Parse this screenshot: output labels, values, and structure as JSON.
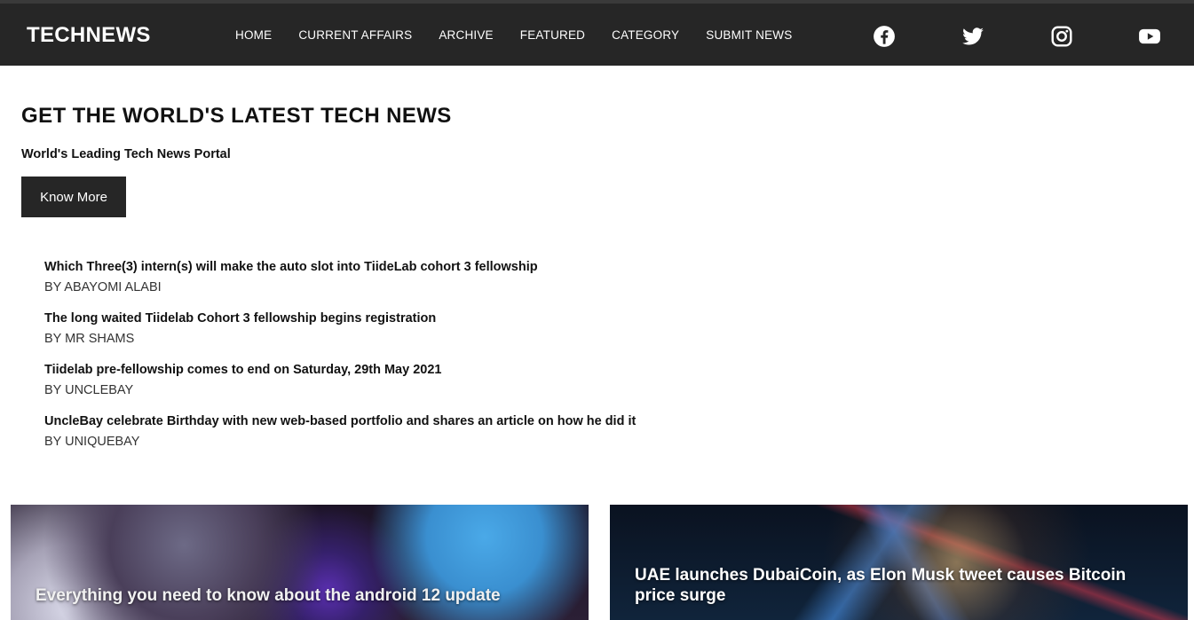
{
  "header": {
    "brand": "TECHNEWS",
    "nav": [
      "HOME",
      "CURRENT AFFAIRS",
      "ARCHIVE",
      "FEATURED",
      "CATEGORY",
      "SUBMIT NEWS"
    ],
    "social_icons": [
      "facebook-icon",
      "twitter-icon",
      "instagram-icon",
      "youtube-icon"
    ]
  },
  "hero": {
    "title": "GET THE WORLD'S LATEST TECH NEWS",
    "subtitle": "World's Leading Tech News Portal",
    "button_label": "Know More"
  },
  "news": [
    {
      "title": "Which Three(3) intern(s) will make the auto slot into TiideLab cohort 3 fellowship",
      "author": "BY ABAYOMI ALABI"
    },
    {
      "title": "The long waited Tiidelab Cohort 3 fellowship begins registration",
      "author": "BY MR SHAMS"
    },
    {
      "title": "Tiidelab pre-fellowship comes to end on Saturday, 29th May 2021",
      "author": "BY UNCLEBAY"
    },
    {
      "title": "UncleBay celebrate Birthday with new web-based portfolio and shares an article on how he did it",
      "author": "BY UNIQUEBAY"
    }
  ],
  "cards": [
    {
      "title": "Everything you need to know about the android 12 update"
    },
    {
      "title": "UAE launches DubaiCoin, as Elon Musk tweet causes Bitcoin price surge"
    }
  ],
  "colors": {
    "header_bg": "#262626",
    "button_bg": "#262626",
    "text": "#111111"
  }
}
